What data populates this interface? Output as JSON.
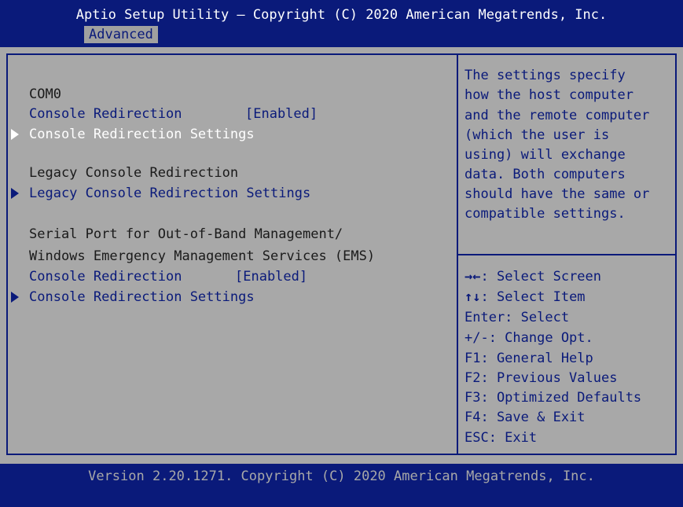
{
  "header": {
    "title": "Aptio Setup Utility – Copyright (C) 2020 American Megatrends, Inc.",
    "active_tab": "Advanced"
  },
  "left_panel": {
    "com0_heading": "COM0",
    "com0_redirection_label": "Console Redirection",
    "com0_redirection_value": "[Enabled]",
    "com0_settings_label": "Console Redirection Settings",
    "legacy_heading": "Legacy Console Redirection",
    "legacy_settings_label": "Legacy Console Redirection Settings",
    "ems_heading_line1": "Serial Port for Out-of-Band Management/",
    "ems_heading_line2": "Windows Emergency Management Services (EMS)",
    "ems_redirection_label": "Console Redirection",
    "ems_redirection_value": "[Enabled]",
    "ems_settings_label": "Console Redirection Settings"
  },
  "help_panel": {
    "description_lines": [
      "The settings specify",
      "how the host computer",
      "and the remote computer",
      "(which the user is",
      "using) will exchange",
      "data. Both computers",
      "should have the same or",
      "compatible settings."
    ],
    "keys": [
      {
        "key": "→←",
        "action": ": Select Screen"
      },
      {
        "key": "↑↓",
        "action": ": Select Item"
      },
      {
        "key": "",
        "action": "Enter: Select"
      },
      {
        "key": "",
        "action": "+/-: Change Opt."
      },
      {
        "key": "",
        "action": "F1: General Help"
      },
      {
        "key": "",
        "action": "F2: Previous Values"
      },
      {
        "key": "",
        "action": "F3: Optimized Defaults"
      },
      {
        "key": "",
        "action": "F4: Save & Exit"
      },
      {
        "key": "",
        "action": "ESC: Exit"
      }
    ]
  },
  "footer": {
    "version": "Version 2.20.1271. Copyright (C) 2020 American Megatrends, Inc."
  },
  "colors": {
    "background_blue": "#0a1a7a",
    "panel_gray": "#a8a8a8",
    "selected_text": "#ffffff"
  }
}
